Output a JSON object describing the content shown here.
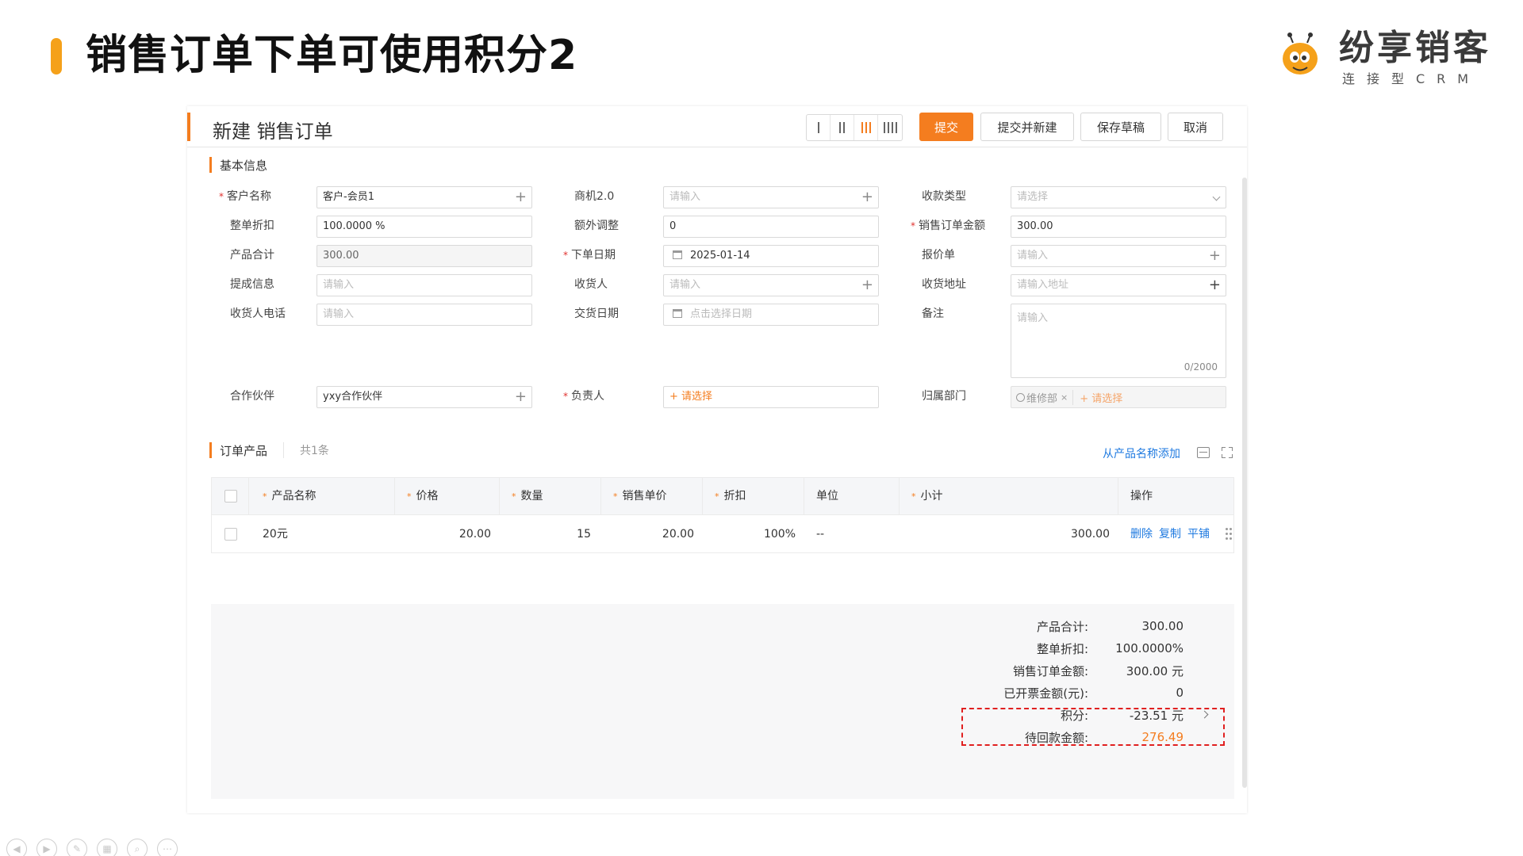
{
  "slide": {
    "title": "销售订单下单可使用积分2",
    "logo_name": "纷享销客",
    "logo_sub": "连接型CRM"
  },
  "colors": {
    "accent": "#f47d1f",
    "slide_accent": "#f5a11a",
    "link": "#1f7ae0",
    "highlight": "#e02020"
  },
  "header": {
    "title": "新建 销售订单",
    "layout_icons": [
      "layout-1-col-icon",
      "layout-2-col-icon",
      "layout-3-col-icon",
      "layout-4-col-icon"
    ],
    "buttons": {
      "submit": "提交",
      "submit_new": "提交并新建",
      "save_draft": "保存草稿",
      "cancel": "取消"
    }
  },
  "basic_info": {
    "section_title": "基本信息",
    "customer_name": {
      "label": "客户名称",
      "value": "客户-会员1"
    },
    "opportunity": {
      "label": "商机2.0",
      "placeholder": "请输入"
    },
    "payment_type": {
      "label": "收款类型",
      "placeholder": "请选择"
    },
    "discount": {
      "label": "整单折扣",
      "value": "100.0000 %"
    },
    "extra_adjust": {
      "label": "额外调整",
      "value": "0"
    },
    "order_amount": {
      "label": "销售订单金额",
      "value": "300.00"
    },
    "product_total": {
      "label": "产品合计",
      "value": "300.00"
    },
    "order_date": {
      "label": "下单日期",
      "value": "2025-01-14"
    },
    "quote": {
      "label": "报价单",
      "placeholder": "请输入"
    },
    "commission": {
      "label": "提成信息",
      "placeholder": "请输入"
    },
    "receiver": {
      "label": "收货人",
      "placeholder": "请输入"
    },
    "ship_address": {
      "label": "收货地址",
      "placeholder": "请输入地址"
    },
    "receiver_phone": {
      "label": "收货人电话",
      "placeholder": "请输入"
    },
    "delivery_date": {
      "label": "交货日期",
      "placeholder": "点击选择日期"
    },
    "remark": {
      "label": "备注",
      "placeholder": "请输入",
      "counter": "0/2000"
    },
    "partner": {
      "label": "合作伙伴",
      "value": "yxy合作伙伴"
    },
    "owner": {
      "label": "负责人",
      "placeholder": "+ 请选择"
    },
    "department": {
      "label": "归属部门",
      "tag": "维修部",
      "tag_remove": "×",
      "placeholder": "+ 请选择"
    }
  },
  "products": {
    "section_title": "订单产品",
    "count": "共1条",
    "add_link": "从产品名称添加",
    "columns": [
      "产品名称",
      "价格",
      "数量",
      "销售单价",
      "折扣",
      "单位",
      "小计",
      "操作"
    ],
    "rows": [
      {
        "name": "20元",
        "price": "20.00",
        "qty": "15",
        "unit_price": "20.00",
        "discount": "100%",
        "unit": "--",
        "subtotal": "300.00",
        "ops": {
          "delete": "删除",
          "copy": "复制",
          "tile": "平铺"
        }
      }
    ]
  },
  "summary": {
    "product_total": {
      "label": "产品合计:",
      "value": "300.00"
    },
    "discount": {
      "label": "整单折扣:",
      "value": "100.0000%"
    },
    "order_amount": {
      "label": "销售订单金额:",
      "value": "300.00 元"
    },
    "invoiced": {
      "label": "已开票金额(元):",
      "value": "0"
    },
    "points": {
      "label": "积分:",
      "value": "-23.51 元"
    },
    "pending": {
      "label": "待回款金额:",
      "value": "276.49"
    }
  }
}
